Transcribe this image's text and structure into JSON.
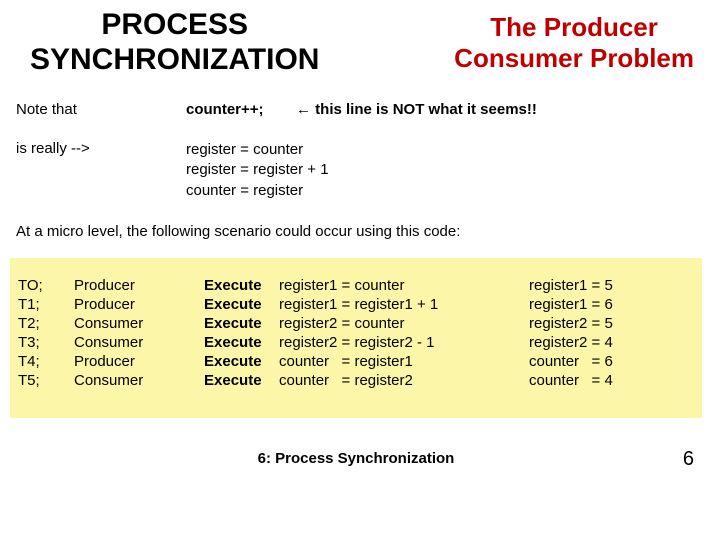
{
  "header": {
    "title_left_l1": "PROCESS",
    "title_left_l2": "SYNCHRONIZATION",
    "title_right_l1": "The Producer",
    "title_right_l2": "Consumer Problem"
  },
  "note": {
    "label": "Note that",
    "code": "counter++;",
    "arrow": "←",
    "warn": "this line is NOT what it seems!!"
  },
  "really": {
    "label": "is really -->",
    "l1": "register = counter",
    "l2": "register = register + 1",
    "l3": "counter = register"
  },
  "micro": "At a micro level, the following scenario could occur using this code:",
  "exec_label": "Execute",
  "rows": [
    {
      "t": "TO;",
      "who": "Producer",
      "op": "register1 = counter",
      "res": "register1 = 5"
    },
    {
      "t": "T1;",
      "who": "Producer",
      "op": "register1 = register1 + 1",
      "res": "register1 = 6"
    },
    {
      "t": "T2;",
      "who": "Consumer",
      "op": "register2 = counter",
      "res": "register2 = 5"
    },
    {
      "t": "T3;",
      "who": "Consumer",
      "op": "register2 = register2 - 1",
      "res": "register2 = 4"
    },
    {
      "t": "T4;",
      "who": "Producer",
      "op": "counter   = register1",
      "res": "counter   = 6"
    },
    {
      "t": "T5;",
      "who": "Consumer",
      "op": "counter   = register2",
      "res": "counter   = 4"
    }
  ],
  "footer": {
    "center": "6: Process Synchronization",
    "page": "6"
  }
}
